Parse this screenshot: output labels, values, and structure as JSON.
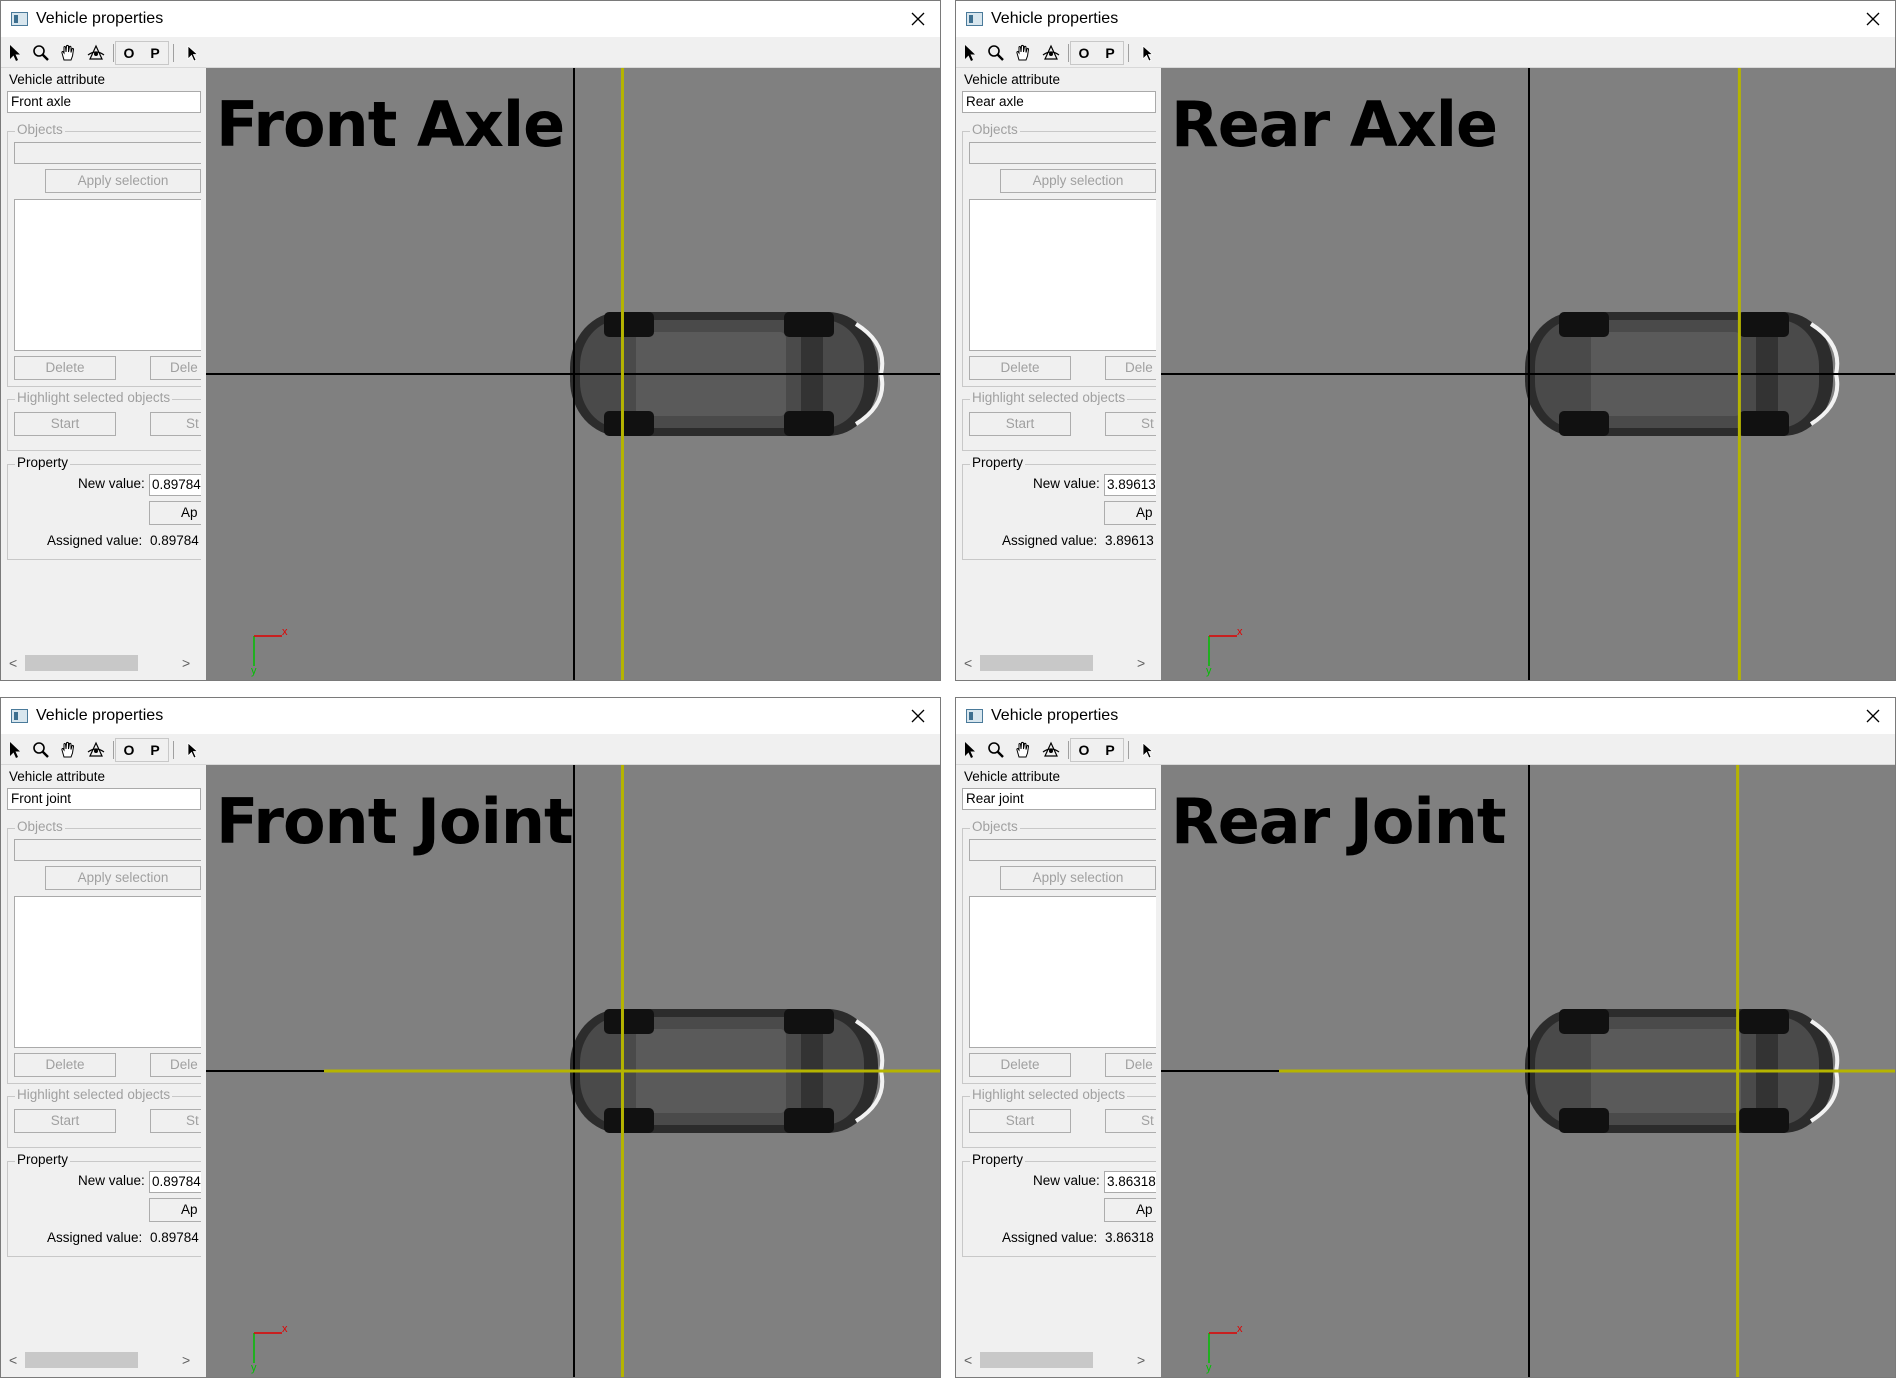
{
  "window_title": "Vehicle properties",
  "toolbar": {
    "tools": [
      "select-icon",
      "zoom-icon",
      "pan-icon",
      "rotate-icon"
    ],
    "ortho_label": "O",
    "perspective_label": "P"
  },
  "labels": {
    "vehicle_attribute": "Vehicle attribute",
    "objects": "Objects",
    "apply_selection": "Apply selection",
    "delete": "Delete",
    "delete_partial": "Dele",
    "highlight": "Highlight selected objects",
    "start": "Start",
    "stop_partial": "St",
    "property": "Property",
    "new_value": "New value:",
    "apply_partial": "Ap",
    "assigned_value": "Assigned value:"
  },
  "axis_labels": {
    "x": "x",
    "y": "y"
  },
  "colors": {
    "viewport_bg": "#808080",
    "guide_line": "#b5b400",
    "reference_line": "#000000"
  },
  "windows": [
    {
      "attribute": "Front axle",
      "viewport_label": "Front Axle",
      "new_value": "0.89784",
      "assigned_value": "0.89784",
      "guide": "vertical",
      "guide_x": 0.89784
    },
    {
      "attribute": "Rear axle",
      "viewport_label": "Rear Axle",
      "new_value": "3.89613",
      "assigned_value": "3.89613",
      "guide": "vertical",
      "guide_x": 3.89613
    },
    {
      "attribute": "Front joint",
      "viewport_label": "Front Joint",
      "new_value": "0.89784",
      "assigned_value": "0.89784",
      "guide": "cross",
      "guide_x": 0.89784
    },
    {
      "attribute": "Rear joint",
      "viewport_label": "Rear Joint",
      "new_value": "3.86318",
      "assigned_value": "3.86318",
      "guide": "cross",
      "guide_x": 3.86318
    }
  ]
}
